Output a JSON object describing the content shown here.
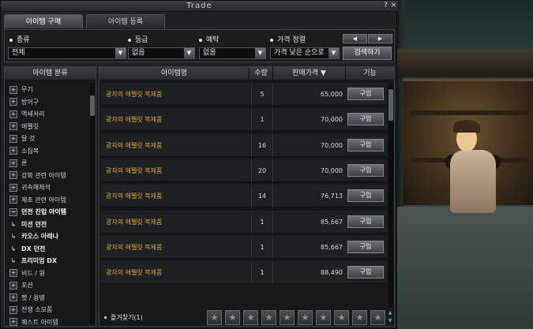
{
  "window": {
    "title": "Trade",
    "help": "?",
    "close": "×"
  },
  "tabs": [
    {
      "label": "아이템 구매"
    },
    {
      "label": "아이템 등록"
    }
  ],
  "filters": {
    "type": {
      "label": "종류",
      "value": "전체"
    },
    "grade": {
      "label": "등급",
      "value": "없음"
    },
    "enchant": {
      "label": "예탁",
      "value": "없음"
    },
    "sort": {
      "label": "가격 정렬",
      "value": "가격 낮은 순으로"
    },
    "prev": "◀",
    "next": "▶",
    "search": "검색하기",
    "dropdown_arrow": "▼"
  },
  "categories": {
    "header": "아이템 분류",
    "expand_glyph": "+",
    "collapse_glyph": "−",
    "sub_glyph": "↳",
    "items": [
      {
        "label": "무기",
        "state": "closed"
      },
      {
        "label": "방어구",
        "state": "closed"
      },
      {
        "label": "액세서리",
        "state": "closed"
      },
      {
        "label": "에펠릿",
        "state": "closed"
      },
      {
        "label": "탈 것",
        "state": "closed"
      },
      {
        "label": "소집복",
        "state": "closed"
      },
      {
        "label": "룬",
        "state": "closed"
      },
      {
        "label": "강화 관련 아이템",
        "state": "closed"
      },
      {
        "label": "귀속해제석",
        "state": "closed"
      },
      {
        "label": "제조 관련 아이템",
        "state": "closed"
      },
      {
        "label": "던전 진입 아이템",
        "state": "open"
      },
      {
        "label": "미션 던전",
        "state": "sub"
      },
      {
        "label": "카오스 아레나",
        "state": "sub"
      },
      {
        "label": "DX 던전",
        "state": "sub"
      },
      {
        "label": "프리미엄 DX",
        "state": "sub"
      },
      {
        "label": "비드 / 윙",
        "state": "closed"
      },
      {
        "label": "포션",
        "state": "closed"
      },
      {
        "label": "펫 / 용병",
        "state": "closed"
      },
      {
        "label": "전쟁 소모품",
        "state": "closed"
      },
      {
        "label": "퀘스트 아이템",
        "state": "closed"
      }
    ]
  },
  "listing": {
    "columns": {
      "name": "아이템명",
      "qty": "수량",
      "price": "판매가격 ▼",
      "action": "기능"
    },
    "buy_label": "구입",
    "rows": [
      {
        "name": "광자의 에펠릿 복제품",
        "qty": "5",
        "price": "65,000"
      },
      {
        "name": "광자의 에펠릿 복제품",
        "qty": "1",
        "price": "70,000"
      },
      {
        "name": "광자의 에펠릿 복제품",
        "qty": "16",
        "price": "70,000"
      },
      {
        "name": "광자의 에펠릿 복제품",
        "qty": "20",
        "price": "70,000"
      },
      {
        "name": "광자의 에펠릿 복제품",
        "qty": "14",
        "price": "76,713"
      },
      {
        "name": "광자의 에펠릿 복제품",
        "qty": "1",
        "price": "85,667"
      },
      {
        "name": "광자의 에펠릿 복제품",
        "qty": "1",
        "price": "85,667"
      },
      {
        "name": "광자의 에펠릿 복제품",
        "qty": "1",
        "price": "88,490"
      }
    ]
  },
  "favorites": {
    "label": "즐겨찾기(1)",
    "star": "★",
    "up": "▲",
    "down": "▼"
  }
}
